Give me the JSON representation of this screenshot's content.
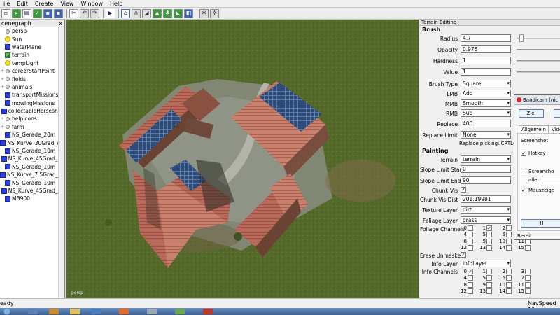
{
  "menu": [
    "ile",
    "Edit",
    "Create",
    "View",
    "Window",
    "Help"
  ],
  "toolbar_icons": [
    "new-file-icon",
    "open-file-icon",
    "recent-icon",
    "save-icon",
    "save-all-icon",
    "cut-icon",
    "undo-icon",
    "redo-icon",
    "play-icon",
    "select-icon",
    "magnet-icon",
    "terrain-tool-icon",
    "terrain-paint-icon",
    "foliage-icon",
    "fill-icon",
    "grid-icon",
    "snap-icon"
  ],
  "scenegraph": {
    "title": "cenegraph",
    "items": [
      {
        "label": "persp",
        "icon": "pin"
      },
      {
        "label": "Sun",
        "icon": "bulb"
      },
      {
        "label": "waterPlane",
        "icon": "cube"
      },
      {
        "label": "terrain",
        "icon": "terrain"
      },
      {
        "label": "tempLight",
        "icon": "bulb"
      },
      {
        "label": "careerStartPoint",
        "icon": "pin"
      },
      {
        "label": "fields",
        "icon": "pin"
      },
      {
        "label": "animals",
        "icon": "pin"
      },
      {
        "label": "transportMissions",
        "icon": "cube"
      },
      {
        "label": "mowingMissions",
        "icon": "cube"
      },
      {
        "label": "collectableHorseshoe",
        "icon": "cube"
      },
      {
        "label": "helpIcons",
        "icon": "pin"
      },
      {
        "label": "farm",
        "icon": "pin"
      },
      {
        "label": "NS_Gerade_20m",
        "icon": "cube"
      },
      {
        "label": "NS_Kurve_30Grad_we",
        "icon": "cube"
      },
      {
        "label": "NS_Gerade_10m",
        "icon": "cube"
      },
      {
        "label": "NS_Kurve_45Grad_en",
        "icon": "cube"
      },
      {
        "label": "NS_Gerade_10m",
        "icon": "cube"
      },
      {
        "label": "NS_Kurve_7.5Grad_en",
        "icon": "cube"
      },
      {
        "label": "NS_Gerade_10m",
        "icon": "cube"
      },
      {
        "label": "NS_Kurve_45Grad_en",
        "icon": "cube"
      },
      {
        "label": "MB900",
        "icon": "cube"
      }
    ]
  },
  "viewport": {
    "camera_label": "persp"
  },
  "terrain_editing": {
    "header": "Terrain Editing",
    "brush_section": "Brush",
    "radius_label": "Radius",
    "radius": "4.7",
    "opacity_label": "Opacity",
    "opacity": "0.975",
    "hardness_label": "Hardness",
    "hardness": "1",
    "value_label": "Value",
    "value": "1",
    "brush_type_label": "Brush Type",
    "brush_type": "Square",
    "lmb_label": "LMB",
    "lmb": "Add",
    "mmb_label": "MMB",
    "mmb": "Smooth",
    "rmb_label": "RMB",
    "rmb": "Sub",
    "replace_label": "Replace",
    "replace": "400",
    "replace_limit_label": "Replace Limit",
    "replace_limit": "None",
    "replace_picking_note": "Replace picking: CRTL-R",
    "painting_section": "Painting",
    "terrain_label": "Terrain",
    "terrain": "terrain",
    "slope_start_label": "Slope Limit Start",
    "slope_start": "0",
    "slope_end_label": "Slope Limit End",
    "slope_end": "90",
    "chunk_vis_label": "Chunk Vis",
    "chunk_vis": "✓",
    "chunk_vis_dist_label": "Chunk Vis Dist",
    "chunk_vis_dist": "201.19981",
    "texture_layer_label": "Texture Layer",
    "texture_layer": "dirt",
    "foliage_layer_label": "Foliage Layer",
    "foliage_layer": "grass",
    "foliage_channels_label": "Foliage Channels",
    "foliage_channels": [
      {
        "n": "0",
        "checked": ""
      },
      {
        "n": "1",
        "checked": "✓"
      },
      {
        "n": "2",
        "checked": ""
      },
      {
        "n": "3",
        "checked": ""
      },
      {
        "n": "4",
        "checked": ""
      },
      {
        "n": "5",
        "checked": ""
      },
      {
        "n": "6",
        "checked": ""
      },
      {
        "n": "7",
        "checked": ""
      },
      {
        "n": "8",
        "checked": ""
      },
      {
        "n": "9",
        "checked": ""
      },
      {
        "n": "10",
        "checked": ""
      },
      {
        "n": "11",
        "checked": ""
      },
      {
        "n": "12",
        "checked": ""
      },
      {
        "n": "13",
        "checked": ""
      },
      {
        "n": "14",
        "checked": ""
      },
      {
        "n": "15",
        "checked": ""
      }
    ],
    "erase_unmasked_label": "Erase Unmasked",
    "erase_unmasked": "✓",
    "info_layer_label": "Info Layer",
    "info_layer": "infoLayer",
    "info_channels_label": "Info Channels",
    "info_channels": [
      {
        "n": "0",
        "checked": "✓"
      },
      {
        "n": "1",
        "checked": ""
      },
      {
        "n": "2",
        "checked": ""
      },
      {
        "n": "3",
        "checked": ""
      },
      {
        "n": "4",
        "checked": ""
      },
      {
        "n": "5",
        "checked": ""
      },
      {
        "n": "6",
        "checked": ""
      },
      {
        "n": "7",
        "checked": ""
      },
      {
        "n": "8",
        "checked": ""
      },
      {
        "n": "9",
        "checked": ""
      },
      {
        "n": "10",
        "checked": ""
      },
      {
        "n": "11",
        "checked": ""
      },
      {
        "n": "12",
        "checked": ""
      },
      {
        "n": "13",
        "checked": ""
      },
      {
        "n": "14",
        "checked": ""
      },
      {
        "n": "15",
        "checked": ""
      }
    ]
  },
  "bandicam": {
    "title": "Bandicam (nic",
    "ziel_button": "Ziel",
    "tabs": [
      "Allgemein",
      "Video"
    ],
    "group_label": "Screenshot",
    "hotkey_label": "Hotkey",
    "hotkey_checked": "✓",
    "screenshot_label": "Screensho",
    "alle_label": "alle",
    "mauszeiger_label": "Mauszeige",
    "mauszeiger_checked": "✓",
    "h_button": "H",
    "status": "Bereit"
  },
  "status": {
    "left": "eady",
    "right": "NavSpeed 10"
  },
  "colors": {
    "grass": "#55692a",
    "roof": "#b9695a",
    "solar": "#2c4a78",
    "panel_bg": "#f0f0f0"
  }
}
